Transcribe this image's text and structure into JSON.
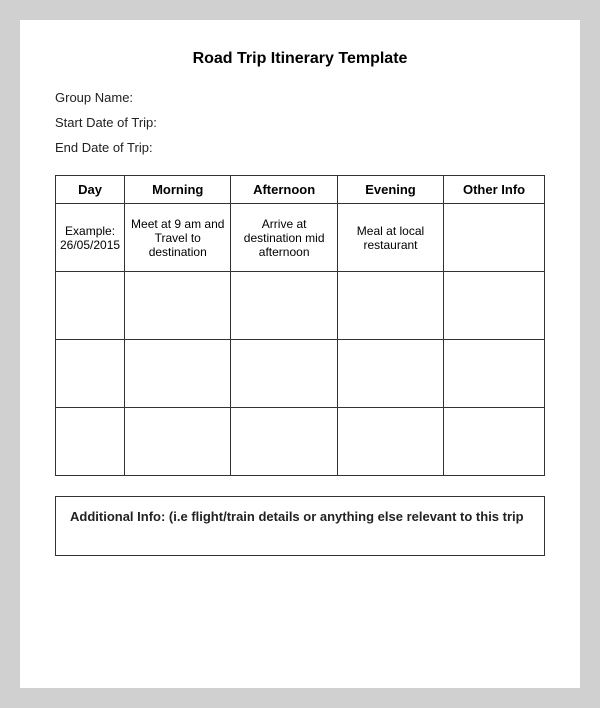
{
  "page": {
    "title": "Road Trip Itinerary Template",
    "fields": {
      "group_name_label": "Group Name:",
      "start_date_label": "Start Date of Trip:",
      "end_date_label": "End Date of Trip:"
    },
    "table": {
      "headers": [
        "Day",
        "Morning",
        "Afternoon",
        "Evening",
        "Other Info"
      ],
      "rows": [
        {
          "day": "Example: 26/05/2015",
          "morning": "Meet at 9 am and Travel to destination",
          "afternoon": "Arrive at destination mid afternoon",
          "evening": "Meal at local restaurant",
          "other": ""
        },
        {
          "day": "",
          "morning": "",
          "afternoon": "",
          "evening": "",
          "other": ""
        },
        {
          "day": "",
          "morning": "",
          "afternoon": "",
          "evening": "",
          "other": ""
        },
        {
          "day": "",
          "morning": "",
          "afternoon": "",
          "evening": "",
          "other": ""
        }
      ]
    },
    "additional_info_label": "Additional Info:  (i.e flight/train details or anything else relevant to this trip"
  }
}
